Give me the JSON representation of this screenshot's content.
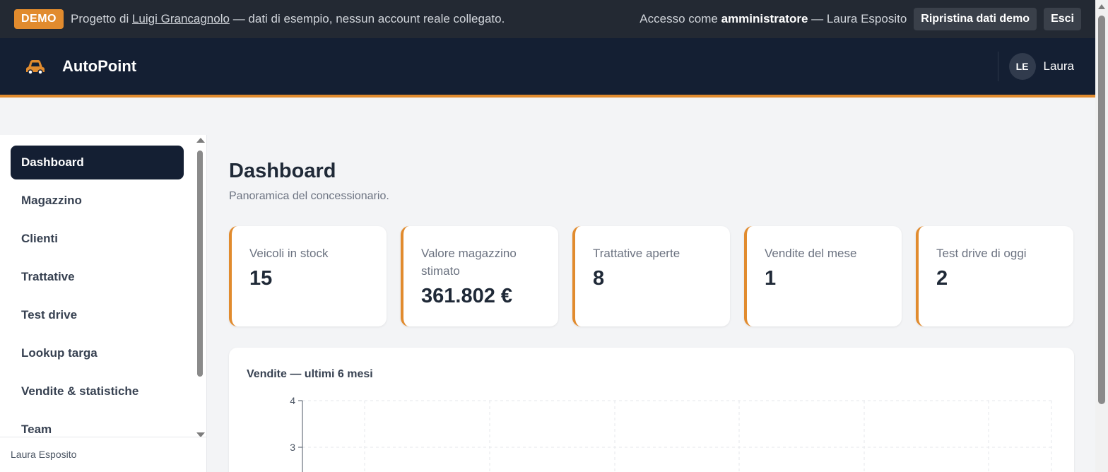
{
  "demo_banner": {
    "badge": "DEMO",
    "text_prefix": "Progetto di",
    "author_link": "Luigi Grancagnolo",
    "text_suffix": "— dati di esempio, nessun account reale collegato.",
    "access_prefix": "Accesso come",
    "access_role": "amministratore",
    "access_user": "— Laura Esposito",
    "reset_button": "Ripristina dati demo",
    "logout_button": "Esci"
  },
  "header": {
    "brand": "AutoPoint",
    "avatar_initials": "LE",
    "user_name": "Laura"
  },
  "sidebar": {
    "items": [
      {
        "label": "Dashboard",
        "active": true
      },
      {
        "label": "Magazzino"
      },
      {
        "label": "Clienti"
      },
      {
        "label": "Trattative"
      },
      {
        "label": "Test drive"
      },
      {
        "label": "Lookup targa"
      },
      {
        "label": "Vendite & statistiche"
      },
      {
        "label": "Team"
      }
    ],
    "footer_user": "Laura Esposito"
  },
  "main": {
    "title": "Dashboard",
    "subtitle": "Panoramica del concessionario."
  },
  "stats": [
    {
      "label": "Veicoli in stock",
      "value": "15"
    },
    {
      "label": "Valore magazzino stimato",
      "value": "361.802 €"
    },
    {
      "label": "Trattative aperte",
      "value": "8"
    },
    {
      "label": "Vendite del mese",
      "value": "1"
    },
    {
      "label": "Test drive di oggi",
      "value": "2"
    }
  ],
  "chart_data": {
    "type": "bar",
    "title": "Vendite — ultimi 6 mesi",
    "y_ticks_visible": [
      "4",
      "3"
    ],
    "ylim_visible": [
      3,
      4
    ],
    "grid": true
  },
  "colors": {
    "accent": "#e18b2e",
    "header_bg": "#141f33",
    "banner_bg": "#232933"
  }
}
